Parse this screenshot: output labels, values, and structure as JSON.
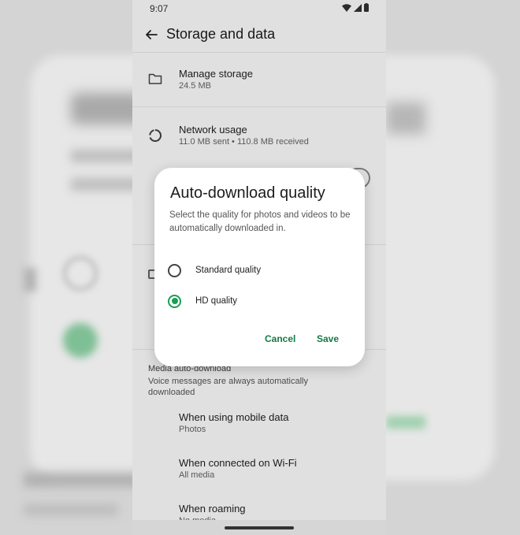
{
  "status_bar": {
    "time": "9:07"
  },
  "app_bar": {
    "title": "Storage and data"
  },
  "rows": [
    {
      "title": "Manage storage",
      "subtitle": "24.5 MB"
    },
    {
      "title": "Network usage",
      "subtitle": "11.0 MB sent • 110.8 MB received"
    }
  ],
  "section": {
    "title": "Media auto-download",
    "subtitle": "Voice messages are always automatically downloaded"
  },
  "auto_rows": [
    {
      "title": "When using mobile data",
      "subtitle": "Photos"
    },
    {
      "title": "When connected on Wi-Fi",
      "subtitle": "All media"
    },
    {
      "title": "When roaming",
      "subtitle": "No media"
    }
  ],
  "dialog": {
    "title": "Auto-download quality",
    "text": "Select the quality for photos and videos to be automatically downloaded in.",
    "options": [
      {
        "label": "Standard quality",
        "selected": false
      },
      {
        "label": "HD quality",
        "selected": true
      }
    ],
    "cancel": "Cancel",
    "save": "Save"
  },
  "colors": {
    "accent": "#1a9e55",
    "button_text": "#137a44"
  }
}
